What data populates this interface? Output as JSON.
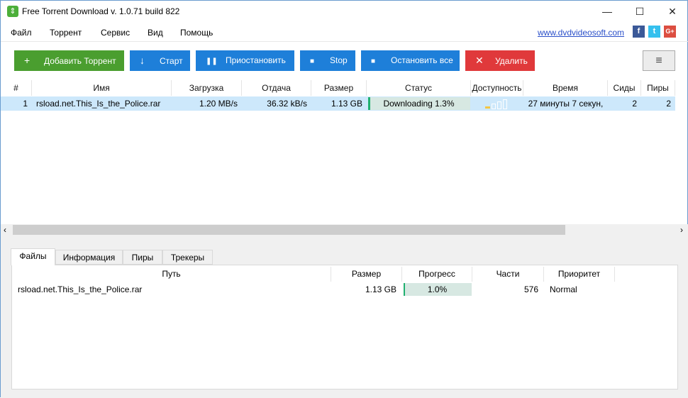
{
  "window": {
    "title": "Free Torrent Download v. 1.0.71 build 822",
    "minimize": "—",
    "maximize": "☐",
    "close": "✕"
  },
  "menu": [
    "Файл",
    "Торрент",
    "Сервис",
    "Вид",
    "Помощь"
  ],
  "link": "www.dvdvideosoft.com",
  "social": {
    "facebook": "f",
    "twitter": "t",
    "google": "G+"
  },
  "toolbar": [
    {
      "label": "Добавить Торрент",
      "icon": "+",
      "color": "#4a9e2f"
    },
    {
      "label": "Старт",
      "icon": "↓",
      "color": "#1e7fd9"
    },
    {
      "label": "Приостановить",
      "icon": "❚❚",
      "color": "#1e7fd9"
    },
    {
      "label": "Stop",
      "icon": "■",
      "color": "#1e7fd9"
    },
    {
      "label": "Остановить все",
      "icon": "■",
      "color": "#1e7fd9"
    },
    {
      "label": "Удалить",
      "icon": "✕",
      "color": "#e0393b"
    }
  ],
  "menu_button": "≡",
  "torrents": {
    "columns": [
      "#",
      "Имя",
      "Загрузка",
      "Отдача",
      "Размер",
      "Статус",
      "Доступность",
      "Время",
      "Сиды",
      "Пиры"
    ],
    "rows": [
      {
        "num": "1",
        "name": "rsload.net.This_Is_the_Police.rar",
        "down": "1.20 MB/s",
        "up": "36.32 kB/s",
        "size": "1.13 GB",
        "status": "Downloading 1.3%",
        "progress": 1.3,
        "availability_level": 1,
        "time": "27 минуты 7 секун,",
        "seeds": "2",
        "peers": "2"
      }
    ]
  },
  "tabs": [
    "Файлы",
    "Информация",
    "Пиры",
    "Трекеры"
  ],
  "files": {
    "columns": [
      "Путь",
      "Размер",
      "Прогресс",
      "Части",
      "Приоритет"
    ],
    "rows": [
      {
        "path": "rsload.net.This_Is_the_Police.rar",
        "size": "1.13 GB",
        "progress": "1.0%",
        "pieces": "576",
        "priority": "Normal"
      }
    ]
  },
  "scroll_left": "‹",
  "scroll_right": "›"
}
